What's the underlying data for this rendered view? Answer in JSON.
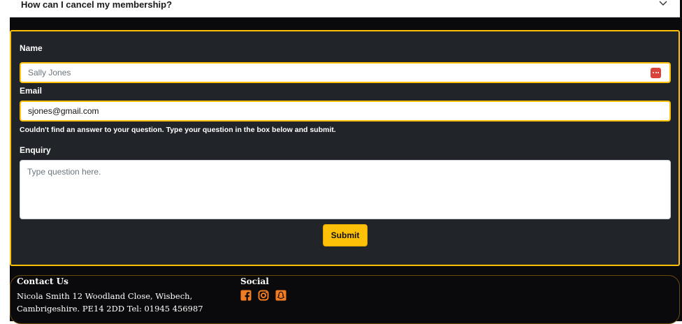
{
  "accordion": {
    "question": "How can I cancel my membership?",
    "chevron_icon": "chevron-down-icon"
  },
  "form": {
    "name_label": "Name",
    "name_placeholder": "Sally Jones",
    "autofill_icon": "password-manager-icon",
    "email_label": "Email",
    "email_value": "sjones@gmail.com",
    "helper_text": "Couldn't find an answer to your question. Type your question in the box below and submit.",
    "enquiry_label": "Enquiry",
    "enquiry_placeholder": "Type question here.",
    "submit_label": "Submit"
  },
  "footer": {
    "contact_heading": "Contact Us",
    "contact_line1": "Nicola Smith 12 Woodland Close, Wisbech,",
    "contact_line2": "Cambrigeshire. PE14 2DD Tel: 01945 456987",
    "social_heading": "Social",
    "social_icons": [
      "facebook-icon",
      "instagram-icon",
      "snapchat-icon"
    ]
  },
  "colors": {
    "accent": "#ffc107",
    "card_bg": "#212529",
    "page_bg": "#0a0a0c",
    "social_icon": "#f47c20"
  }
}
